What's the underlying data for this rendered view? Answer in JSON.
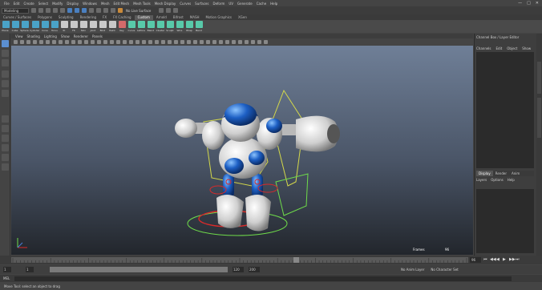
{
  "menubar": {
    "items": [
      "File",
      "Edit",
      "Create",
      "Select",
      "Modify",
      "Display",
      "Windows",
      "Mesh",
      "Edit Mesh",
      "Mesh Tools",
      "Mesh Display",
      "Curves",
      "Surfaces",
      "Deform",
      "UV",
      "Generate",
      "Cache",
      "Help"
    ]
  },
  "statusline": {
    "mode": "Modeling",
    "live_surface": "No Live Surface"
  },
  "shelf": {
    "tabs": [
      "Curves / Surfaces",
      "Polygons",
      "Sculpting",
      "Rendering",
      "FX",
      "FX Caching",
      "Custom",
      "Arnold",
      "Bifrost",
      "MASH",
      "Motion Graphics",
      "XGen"
    ],
    "active_tab": 6,
    "icons": [
      {
        "label": "Plane",
        "color": "#4aa3c8"
      },
      {
        "label": "Cube",
        "color": "#4aa3c8"
      },
      {
        "label": "Sphere",
        "color": "#4aa3c8"
      },
      {
        "label": "Cylinder",
        "color": "#4aa3c8"
      },
      {
        "label": "Cone",
        "color": "#4aa3c8"
      },
      {
        "label": "Torus",
        "color": "#4aa3c8"
      },
      {
        "label": "IK",
        "color": "#c9c9c9"
      },
      {
        "label": "FK",
        "color": "#c9c9c9"
      },
      {
        "label": "Skin",
        "color": "#c9c9c9"
      },
      {
        "label": "Joint",
        "color": "#c9c9c9"
      },
      {
        "label": "Bind",
        "color": "#c9c9c9"
      },
      {
        "label": "Paint",
        "color": "#c9c9c9"
      },
      {
        "label": "Key",
        "color": "#d36a6a"
      },
      {
        "label": "Curve",
        "color": "#58c9a9"
      },
      {
        "label": "Lattice",
        "color": "#58c9a9"
      },
      {
        "label": "Blend",
        "color": "#58c9a9"
      },
      {
        "label": "Cluster",
        "color": "#58c9a9"
      },
      {
        "label": "Sculpt",
        "color": "#58c9a9"
      },
      {
        "label": "Wire",
        "color": "#58c9a9"
      },
      {
        "label": "Wrap",
        "color": "#58c9a9"
      },
      {
        "label": "Bend",
        "color": "#58c9a9"
      }
    ]
  },
  "viewport": {
    "menu": [
      "View",
      "Shading",
      "Lighting",
      "Show",
      "Renderer",
      "Panels"
    ],
    "hud_label": "Frames",
    "hud_value": "96"
  },
  "outliner": {
    "title": "Channel Box / Layer Editor",
    "menu": [
      "Channels",
      "Edit",
      "Object",
      "Show"
    ]
  },
  "layers": {
    "tabs": [
      "Display",
      "Render",
      "Anim"
    ],
    "active_tab": 0,
    "menu": [
      "Layers",
      "Options",
      "Help"
    ]
  },
  "timeslider": {
    "current_frame": "96",
    "playback": [
      "⏮",
      "◀◀",
      "◀",
      "▶",
      "▶▶",
      "⏭"
    ]
  },
  "rangeslider": {
    "start": "1",
    "end": "120",
    "anim_end": "200",
    "anim_layer": "No Anim Layer",
    "char_set": "No Character Set"
  },
  "cmdline": {
    "label": "MEL"
  },
  "helpline": {
    "text": "Move Tool: select an object to drag"
  },
  "colors": {
    "robot_blue": "#1d5fc4",
    "robot_white": "#dcdcdc",
    "manip_yellow": "#d4d84a",
    "manip_red": "#d82a2a",
    "manip_green": "#6fdc4a"
  }
}
